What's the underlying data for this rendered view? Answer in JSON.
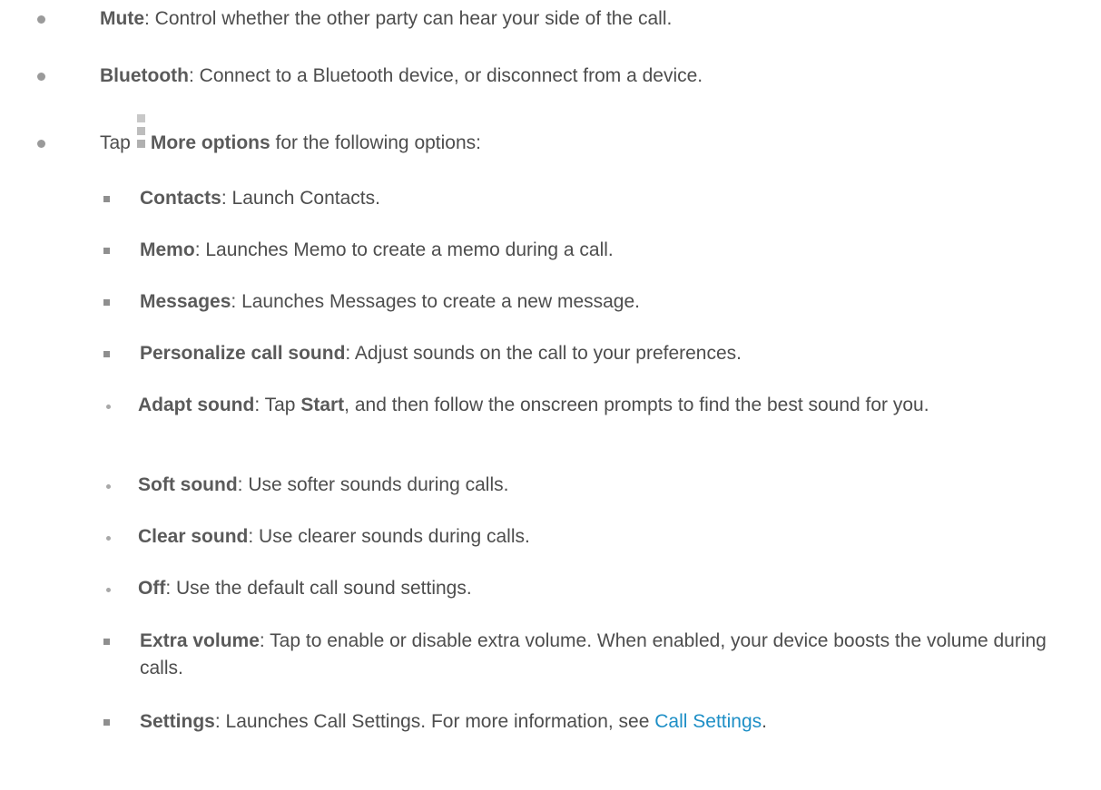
{
  "bullets": [
    {
      "term": "Mute",
      "desc": ": Control whether the other party can hear your side of the call."
    },
    {
      "term": "Bluetooth",
      "desc": ": Connect to a Bluetooth device, or disconnect from a device."
    }
  ],
  "more_options": {
    "prefix": "Tap",
    "label": "More options",
    "suffix": " for the following options:"
  },
  "sub_items": {
    "contacts": {
      "term": "Contacts",
      "desc": ": Launch Contacts."
    },
    "memo": {
      "term": "Memo",
      "desc": ": Launches Memo to create a memo during a call."
    },
    "messages": {
      "term": "Messages",
      "desc": ": Launches Messages to create a new message."
    },
    "personalize": {
      "term": "Personalize call sound",
      "desc": ": Adjust sounds on the call to your preferences."
    },
    "extra_volume": {
      "term": "Extra volume",
      "desc": ": Tap to enable or disable extra volume. When enabled, your device boosts the volume during calls."
    },
    "settings": {
      "term": "Settings",
      "desc": ": Launches Call Settings. For more information, see ",
      "link": "Call Settings",
      "end": "."
    }
  },
  "sound_options": {
    "adapt": {
      "term": "Adapt sound",
      "desc1": ": Tap ",
      "start": "Start",
      "desc2": ", and then follow the onscreen prompts to find the best sound for you."
    },
    "soft": {
      "term": "Soft sound",
      "desc": ": Use softer sounds during calls."
    },
    "clear": {
      "term": "Clear sound",
      "desc": ": Use clearer sounds during calls."
    },
    "off": {
      "term": "Off",
      "desc": ": Use the default call sound settings."
    }
  },
  "colors": {
    "text": "#4d4d4d",
    "link": "#1e8fc6",
    "bullet": "#9a9a9a"
  },
  "icons": {
    "more_options": "more-options-icon"
  }
}
